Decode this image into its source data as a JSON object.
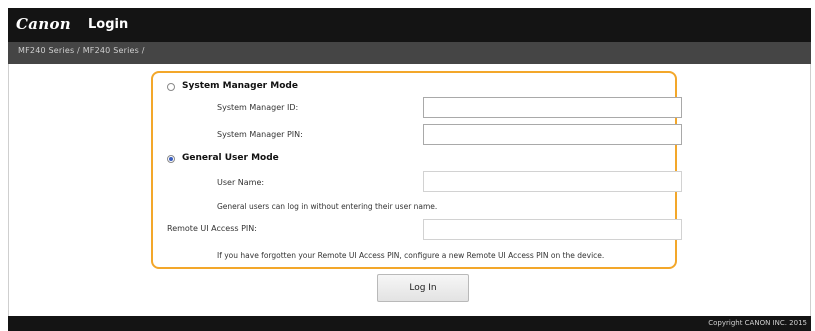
{
  "header": {
    "brand": "Canon",
    "title": "Login"
  },
  "breadcrumb": "MF240 Series / MF240 Series /",
  "form": {
    "system_manager_mode": {
      "label": "System Manager Mode",
      "selected": false,
      "id_label": "System Manager ID:",
      "id_value": "",
      "pin_label": "System Manager PIN:",
      "pin_value": ""
    },
    "general_user_mode": {
      "label": "General User Mode",
      "selected": true,
      "user_name_label": "User Name:",
      "user_name_value": "",
      "note": "General users can log in without entering their user name."
    },
    "remote_ui_pin": {
      "label": "Remote UI Access PIN:",
      "value": "",
      "note": "If you have forgotten your Remote UI Access PIN, configure a new Remote UI Access PIN on the device."
    },
    "highlight_color": "#f3a72a"
  },
  "login_button": "Log In",
  "footer": {
    "copyright": "Copyright CANON INC. 2015"
  }
}
